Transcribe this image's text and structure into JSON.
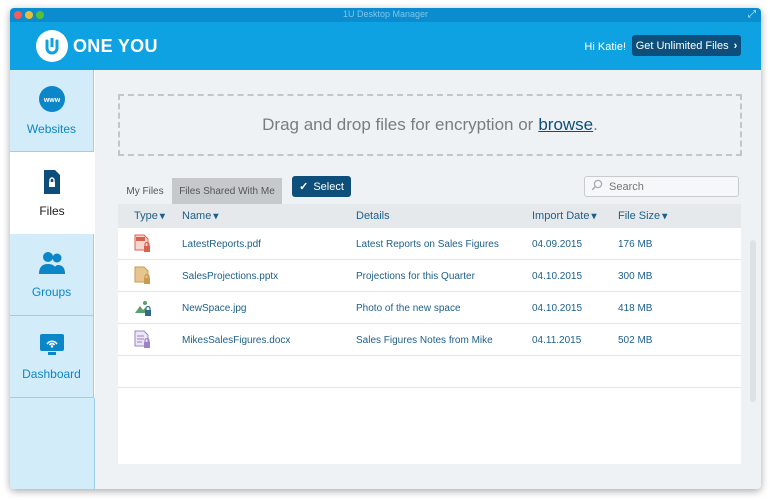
{
  "window": {
    "title": "1U Desktop Manager"
  },
  "header": {
    "brand": "ONE YOU",
    "greeting": "Hi Katie!",
    "cta_label": "Get Unlimited Files"
  },
  "sidebar": {
    "items": [
      {
        "label": "Websites",
        "icon": "www-icon"
      },
      {
        "label": "Files",
        "icon": "file-lock-icon"
      },
      {
        "label": "Groups",
        "icon": "users-icon"
      },
      {
        "label": "Dashboard",
        "icon": "dashboard-icon"
      }
    ],
    "active": "Files"
  },
  "dropzone": {
    "text": "Drag and drop files for encryption or",
    "link": "browse",
    "suffix": "."
  },
  "tabs": {
    "my_files": "My Files",
    "shared": "Files Shared With Me",
    "active": "Files Shared With Me"
  },
  "toolbar": {
    "select_label": "Select",
    "search_placeholder": "Search"
  },
  "table": {
    "columns": {
      "type": "Type",
      "name": "Name",
      "details": "Details",
      "import_date": "Import Date",
      "file_size": "File Size"
    },
    "rows": [
      {
        "type": "pdf",
        "name": "LatestReports.pdf",
        "details": "Latest Reports on Sales Figures",
        "date": "04.09.2015",
        "size": "176 MB"
      },
      {
        "type": "pptx",
        "name": "SalesProjections.pptx",
        "details": "Projections for this Quarter",
        "date": "04.10.2015",
        "size": "300 MB"
      },
      {
        "type": "jpg",
        "name": "NewSpace.jpg",
        "details": "Photo of the new space",
        "date": "04.10.2015",
        "size": "418 MB"
      },
      {
        "type": "docx",
        "name": "MikesSalesFigures.docx",
        "details": "Sales Figures Notes from Mike",
        "date": "04.11.2015",
        "size": "502 MB"
      }
    ]
  },
  "colors": {
    "brand": "#0ea2e3",
    "dark_accent": "#0d4f7a",
    "sidebar_bg": "#d3ecf9"
  }
}
